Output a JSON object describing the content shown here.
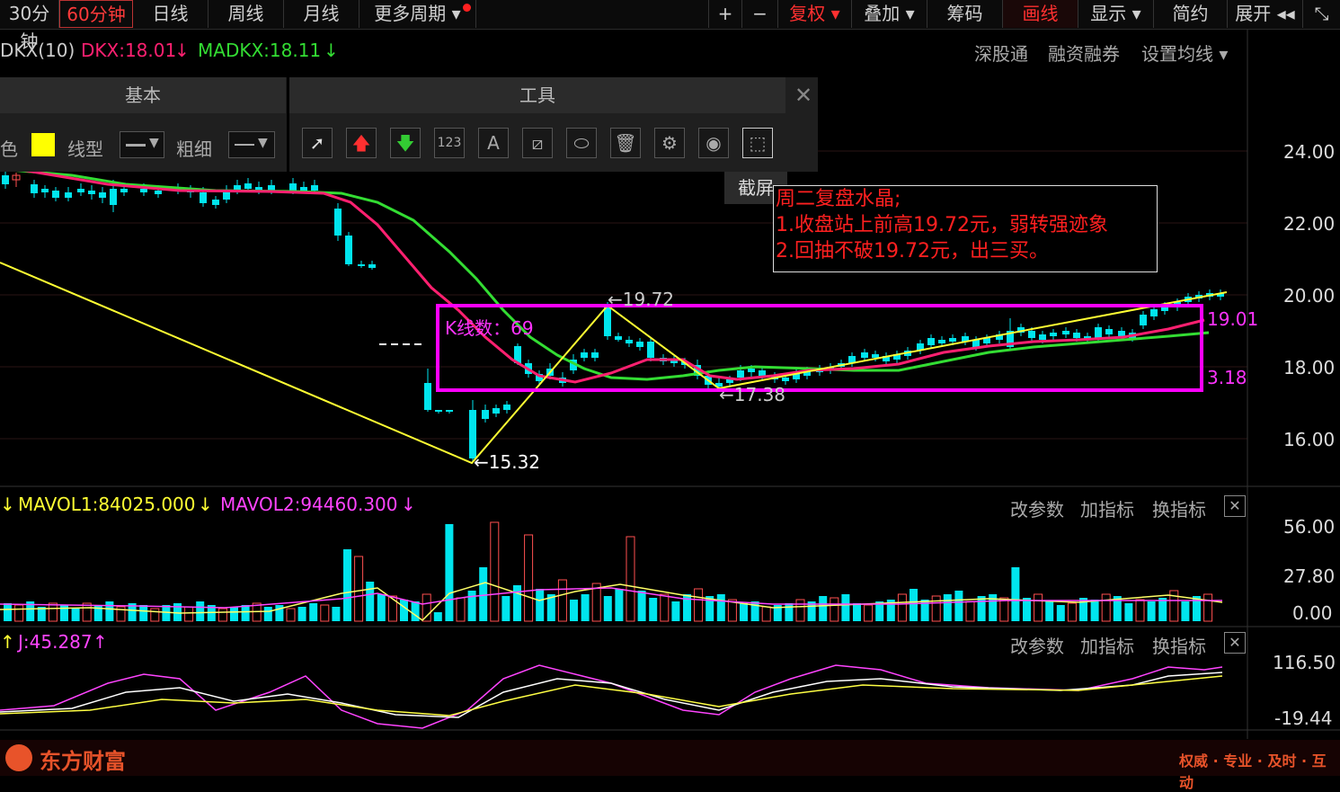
{
  "toolbar": {
    "left": [
      {
        "label": "30分钟",
        "active": false
      },
      {
        "label": "60分钟",
        "active": true
      },
      {
        "label": "日线"
      },
      {
        "label": "周线"
      },
      {
        "label": "月线"
      },
      {
        "label": "更多周期 ▾"
      }
    ],
    "right": [
      "+",
      "−",
      "复权 ▾",
      "叠加 ▾",
      "筹码",
      "画线",
      "显示 ▾",
      "简约",
      "展开 ◂◂"
    ],
    "collapse_icon": "⤡"
  },
  "indicator_main": {
    "name": "DKX(10)",
    "dkx": "DKX:18.01",
    "madkx": "MADKX:18.11",
    "links": [
      "深股通",
      "融资融券",
      "设置均线 ▾"
    ]
  },
  "draw_panel": {
    "tab_basic": "基本",
    "tab_tools": "工具",
    "color_label": "色",
    "line_type_label": "线型",
    "thickness_label": "粗细",
    "tooltip": "截屏"
  },
  "note": {
    "line1": "周二复盘水晶;",
    "line2": "1.收盘站上前高19.72元，弱转强迹象",
    "line3": "2.回抽不破19.72元，出三买。"
  },
  "annotations": {
    "kline_count": "K线数：69",
    "high": "←19.72",
    "low": "←15.32",
    "mid_low": "←17.38",
    "box_right_top": "19.01",
    "box_right_bottom": "3.18"
  },
  "price_axis": [
    "24.00",
    "22.00",
    "20.00",
    "18.00",
    "16.00"
  ],
  "vol_panel": {
    "mavol1": "MAVOL1:84025.000",
    "mavol2": "MAVOL2:94460.300",
    "axis": [
      "56.00",
      "27.80",
      "0.00"
    ],
    "links": [
      "改参数",
      "加指标",
      "换指标"
    ]
  },
  "kdj_panel": {
    "j": "J:45.287",
    "axis": [
      "116.50",
      "-19.44"
    ],
    "links": [
      "改参数",
      "加指标",
      "换指标"
    ]
  },
  "footer": {
    "brand": "东方财富",
    "slogan": "权威 · 专业 · 及时 · 互动"
  },
  "colors": {
    "up": "#ff5050",
    "down": "#00e5ee",
    "dkx": "#ff2070",
    "madkx": "#33dd33",
    "trend": "#ffff33",
    "box": "#ff00ff",
    "note": "#ff2020"
  }
}
